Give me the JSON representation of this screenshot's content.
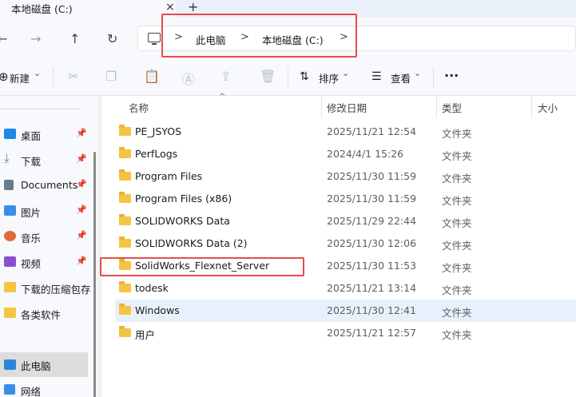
{
  "tab": {
    "title": "本地磁盘 (C:)",
    "close": "×",
    "new_tab": "+"
  },
  "nav": {
    "back": "←",
    "forward": "→",
    "up": "↑",
    "refresh": "↻"
  },
  "address": {
    "crumbs": [
      "此电脑",
      "本地磁盘 (C:)"
    ],
    "sep": ">"
  },
  "toolbar": {
    "new_label": "新建",
    "sort_label": "排序",
    "view_label": "查看",
    "more": "···",
    "chevron": "⌄"
  },
  "sidebar": {
    "items": [
      {
        "label": "桌面",
        "icon": "desktop-icon",
        "color": "#1e88e5",
        "pinned": true
      },
      {
        "label": "下载",
        "icon": "download-icon",
        "color": "#2e9e5b",
        "pinned": true
      },
      {
        "label": "Documents",
        "icon": "documents-icon",
        "color": "#6b7b8c",
        "pinned": true
      },
      {
        "label": "图片",
        "icon": "pictures-icon",
        "color": "#3a8ee6",
        "pinned": true
      },
      {
        "label": "音乐",
        "icon": "music-icon",
        "color": "#e06a3b",
        "pinned": true
      },
      {
        "label": "视频",
        "icon": "video-icon",
        "color": "#8a4fd1",
        "pinned": true
      },
      {
        "label": "下载的压缩包存",
        "icon": "folder-icon",
        "color": "#f5c443",
        "pinned": false
      },
      {
        "label": "各类软件",
        "icon": "folder-icon",
        "color": "#f5c443",
        "pinned": false
      }
    ],
    "this_pc": "此电脑",
    "network": "网络"
  },
  "columns": {
    "name": "名称",
    "modified": "修改日期",
    "type": "类型",
    "size": "大小"
  },
  "files": [
    {
      "name": "PE_JSYOS",
      "date": "2025/11/21 12:54",
      "type": "文件夹"
    },
    {
      "name": "PerfLogs",
      "date": "2024/4/1 15:26",
      "type": "文件夹"
    },
    {
      "name": "Program Files",
      "date": "2025/11/30 11:59",
      "type": "文件夹"
    },
    {
      "name": "Program Files (x86)",
      "date": "2025/11/30 11:59",
      "type": "文件夹"
    },
    {
      "name": "SOLIDWORKS Data",
      "date": "2025/11/29 22:44",
      "type": "文件夹"
    },
    {
      "name": "SOLIDWORKS Data (2)",
      "date": "2025/11/30 12:06",
      "type": "文件夹"
    },
    {
      "name": "SolidWorks_Flexnet_Server",
      "date": "2025/11/30 11:53",
      "type": "文件夹"
    },
    {
      "name": "todesk",
      "date": "2025/11/21 13:14",
      "type": "文件夹"
    },
    {
      "name": "Windows",
      "date": "2025/11/30 12:41",
      "type": "文件夹"
    },
    {
      "name": "用户",
      "date": "2025/11/21 12:57",
      "type": "文件夹"
    }
  ],
  "colors": {
    "accent_highlight": "#e84b4b",
    "folder": "#f5c443",
    "selected_row": "#e8f1fb"
  }
}
